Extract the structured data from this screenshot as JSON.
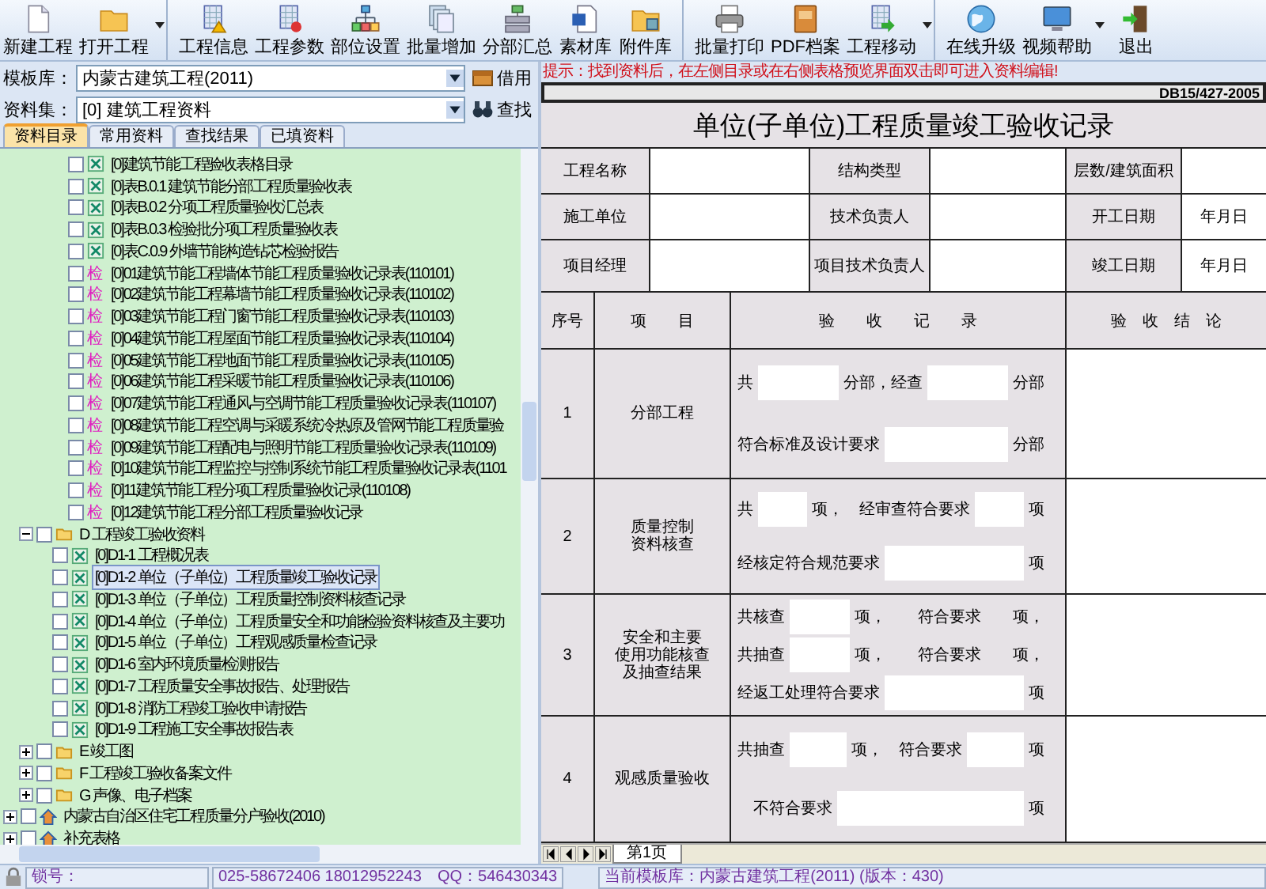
{
  "toolbar": {
    "buttons": [
      {
        "label": "新建工程",
        "dropdown": false,
        "separator_after": false
      },
      {
        "label": "打开工程",
        "dropdown": true,
        "separator_after": true
      },
      {
        "label": "工程信息",
        "dropdown": false,
        "separator_after": false
      },
      {
        "label": "工程参数",
        "dropdown": false,
        "separator_after": false
      },
      {
        "label": "部位设置",
        "dropdown": false,
        "separator_after": false
      },
      {
        "label": "批量增加",
        "dropdown": false,
        "separator_after": false
      },
      {
        "label": "分部汇总",
        "dropdown": false,
        "separator_after": false
      },
      {
        "label": "素材库",
        "dropdown": false,
        "separator_after": false
      },
      {
        "label": "附件库",
        "dropdown": false,
        "separator_after": true
      },
      {
        "label": "批量打印",
        "dropdown": false,
        "separator_after": false
      },
      {
        "label": "PDF档案",
        "dropdown": false,
        "separator_after": false
      },
      {
        "label": "工程移动",
        "dropdown": true,
        "separator_after": true
      },
      {
        "label": "在线升级",
        "dropdown": false,
        "separator_after": false
      },
      {
        "label": "视频帮助",
        "dropdown": true,
        "separator_after": false
      },
      {
        "label": "退出",
        "dropdown": false,
        "separator_after": false
      }
    ]
  },
  "template_row": {
    "label": "模板库：",
    "value": "内蒙古建筑工程(2011)",
    "button": "借用"
  },
  "dataset_row": {
    "label": "资料集：",
    "value": "[0] 建筑工程资料",
    "button": "查找"
  },
  "hint": "提示：找到资料后，在左侧目录或在右侧表格预览界面双击即可进入资料编辑!",
  "tabs": [
    {
      "label": "资料目录",
      "selected": true
    },
    {
      "label": "常用资料",
      "selected": false
    },
    {
      "label": "查找结果",
      "selected": false
    },
    {
      "label": "已填资料",
      "selected": false
    }
  ],
  "tree": {
    "items": [
      {
        "children": [
          {
            "children": [
              {
                "children": [
                  {
                    "kind": "sheet",
                    "label": "[0]建筑节能工程验收表格目录",
                    "checked": false,
                    "selected": false
                  },
                  {
                    "kind": "sheet",
                    "label": "[0]表B.0.1 建筑节能分部工程质量验收表",
                    "checked": false,
                    "selected": false
                  },
                  {
                    "kind": "sheet",
                    "label": "[0]表B.0.2 分项工程质量验收汇总表",
                    "checked": false,
                    "selected": false
                  },
                  {
                    "kind": "sheet",
                    "label": "[0]表B.0.3 检验批分项工程质量验收表",
                    "checked": false,
                    "selected": false
                  },
                  {
                    "kind": "sheet",
                    "label": "[0]表C.0.9 外墙节能构造钻芯检验报告",
                    "checked": false,
                    "selected": false
                  },
                  {
                    "kind": "check",
                    "badge": "检",
                    "label": "[0]01建筑节能工程墙体节能工程质量验收记录表(110101)",
                    "checked": false,
                    "selected": false
                  },
                  {
                    "kind": "check",
                    "badge": "检",
                    "label": "[0]02建筑节能工程幕墙节能工程质量验收记录表(110102)",
                    "checked": false,
                    "selected": false
                  },
                  {
                    "kind": "check",
                    "badge": "检",
                    "label": "[0]03建筑节能工程门窗节能工程质量验收记录表(110103)",
                    "checked": false,
                    "selected": false
                  },
                  {
                    "kind": "check",
                    "badge": "检",
                    "label": "[0]04建筑节能工程屋面节能工程质量验收记录表(110104)",
                    "checked": false,
                    "selected": false
                  },
                  {
                    "kind": "check",
                    "badge": "检",
                    "label": "[0]05建筑节能工程地面节能工程质量验收记录表(110105)",
                    "checked": false,
                    "selected": false
                  },
                  {
                    "kind": "check",
                    "badge": "检",
                    "label": "[0]06建筑节能工程采暖节能工程质量验收记录表(110106)",
                    "checked": false,
                    "selected": false
                  },
                  {
                    "kind": "check",
                    "badge": "检",
                    "label": "[0]07建筑节能工程通风与空调节能工程质量验收记录表(110107)",
                    "checked": false,
                    "selected": false
                  },
                  {
                    "kind": "check",
                    "badge": "检",
                    "label": "[0]08建筑节能工程空调与采暖系统冷热原及管网节能工程质量验",
                    "checked": false,
                    "selected": false
                  },
                  {
                    "kind": "check",
                    "badge": "检",
                    "label": "[0]09建筑节能工程配电与照明节能工程质量验收记录表(110109)",
                    "checked": false,
                    "selected": false
                  },
                  {
                    "kind": "check",
                    "badge": "检",
                    "label": "[0]10建筑节能工程监控与控制系统节能工程质量验收记录表(1101",
                    "checked": false,
                    "selected": false
                  },
                  {
                    "kind": "check",
                    "badge": "检",
                    "label": "[0]11建筑节能工程分项工程质量验收记录(110108)",
                    "checked": false,
                    "selected": false
                  },
                  {
                    "kind": "check",
                    "badge": "检",
                    "label": "[0]12建筑节能工程分部工程质量验收记录",
                    "checked": false,
                    "selected": false
                  }
                ]
              }
            ]
          },
          {
            "kind": "folder",
            "label": "D 工程竣工验收资料",
            "checked": false,
            "selected": false,
            "expanded": true,
            "children": [
              {
                "kind": "sheet",
                "label": "[0]D1-1 工程概况表",
                "checked": false,
                "selected": false
              },
              {
                "kind": "sheet",
                "label": "[0]D1-2 单位（子单位）工程质量竣工验收记录",
                "checked": false,
                "selected": true
              },
              {
                "kind": "sheet",
                "label": "[0]D1-3 单位（子单位）工程质量控制资料核查记录",
                "checked": false,
                "selected": false
              },
              {
                "kind": "sheet",
                "label": "[0]D1-4 单位（子单位）工程质量安全和功能检验资料核查及主要功",
                "checked": false,
                "selected": false
              },
              {
                "kind": "sheet",
                "label": "[0]D1-5 单位（子单位）工程观感质量检查记录",
                "checked": false,
                "selected": false
              },
              {
                "kind": "sheet",
                "label": "[0]D1-6 室内环境质量检测报告",
                "checked": false,
                "selected": false
              },
              {
                "kind": "sheet",
                "label": "[0]D1-7 工程质量安全事故报告、处理报告",
                "checked": false,
                "selected": false
              },
              {
                "kind": "sheet",
                "label": "[0]D1-8 消防工程竣工验收申请报告",
                "checked": false,
                "selected": false
              },
              {
                "kind": "sheet",
                "label": "[0]D1-9 工程施工安全事故报告表",
                "checked": false,
                "selected": false
              }
            ]
          },
          {
            "kind": "folder",
            "label": "E 竣工图",
            "checked": false,
            "selected": false,
            "expanded": false
          },
          {
            "kind": "folder",
            "label": "F 工程竣工验收备案文件",
            "checked": false,
            "selected": false,
            "expanded": false
          },
          {
            "kind": "folder",
            "label": "G 声像、电子档案",
            "checked": false,
            "selected": false,
            "expanded": false
          }
        ]
      },
      {
        "kind": "house",
        "label": "内蒙古自治区住宅工程质量分户验收(2010)",
        "checked": false,
        "selected": false,
        "expanded": false
      },
      {
        "kind": "house",
        "label": "补充表格",
        "checked": false,
        "selected": false,
        "expanded": false
      }
    ]
  },
  "form": {
    "code": "DB15/427-2005",
    "title": "单位(子单位)工程质量竣工验收记录",
    "info_rows": [
      [
        {
          "label": "工程名称"
        },
        {
          "label": "结构类型"
        },
        {
          "label": "层数/建筑面积"
        }
      ],
      [
        {
          "label": "施工单位"
        },
        {
          "label": "技术负责人"
        },
        {
          "label": "开工日期",
          "value": "年月日"
        }
      ],
      [
        {
          "label": "项目经理"
        },
        {
          "label": "项目技术负责人"
        },
        {
          "label": "竣工日期",
          "value": "年月日"
        }
      ]
    ],
    "headers": [
      "序号",
      "项　　目",
      "验　　收　　记　　录",
      "验　收　结　论"
    ],
    "rows": [
      {
        "no": "1",
        "item_lines": [
          "分部工程"
        ],
        "lines": [
          [
            {
              "kind": "text",
              "text": "共"
            },
            {
              "kind": "blank"
            },
            {
              "kind": "text",
              "text": "分部，经查"
            },
            {
              "kind": "blank"
            },
            {
              "kind": "text",
              "text": "分部"
            }
          ],
          [
            {
              "kind": "text",
              "text": "符合标准及设计要求"
            },
            {
              "kind": "blank"
            },
            {
              "kind": "text",
              "text": "分部"
            }
          ]
        ]
      },
      {
        "no": "2",
        "item_lines": [
          "质量控制",
          "资料核查"
        ],
        "lines": [
          [
            {
              "kind": "text",
              "text": "共"
            },
            {
              "kind": "blank"
            },
            {
              "kind": "text",
              "text": "项，　经审查符合要求"
            },
            {
              "kind": "blank"
            },
            {
              "kind": "text",
              "text": "项"
            }
          ],
          [
            {
              "kind": "text",
              "text": "经核定符合规范要求"
            },
            {
              "kind": "blank"
            },
            {
              "kind": "text",
              "text": "项"
            }
          ]
        ]
      },
      {
        "no": "3",
        "item_lines": [
          "安全和主要",
          "使用功能核查",
          "及抽查结果"
        ],
        "lines": [
          [
            {
              "kind": "text",
              "text": "共核查"
            },
            {
              "kind": "blank"
            },
            {
              "kind": "text",
              "text": "项，　　符合要求　　项，"
            }
          ],
          [
            {
              "kind": "text",
              "text": "共抽查"
            },
            {
              "kind": "blank"
            },
            {
              "kind": "text",
              "text": "项，　　符合要求　　项，"
            }
          ],
          [
            {
              "kind": "text",
              "text": "经返工处理符合要求"
            },
            {
              "kind": "blank"
            },
            {
              "kind": "text",
              "text": "项"
            }
          ]
        ]
      },
      {
        "no": "4",
        "item_lines": [
          "观感质量验收"
        ],
        "lines": [
          [
            {
              "kind": "text",
              "text": "共抽查"
            },
            {
              "kind": "blank"
            },
            {
              "kind": "text",
              "text": "项，　符合要求"
            },
            {
              "kind": "blank"
            },
            {
              "kind": "text",
              "text": "项"
            }
          ],
          [
            {
              "kind": "text",
              "text": "　不符合要求"
            },
            {
              "kind": "blank"
            },
            {
              "kind": "text",
              "text": "项"
            }
          ]
        ]
      }
    ]
  },
  "sheet_tabs": [
    {
      "label": "第1页",
      "selected": true
    }
  ],
  "status_bar": {
    "lock_label": "锁号：",
    "contact": "025-58672406 18012952243　QQ：546430343",
    "current": "当前模板库：内蒙古建筑工程(2011) (版本：430)"
  }
}
